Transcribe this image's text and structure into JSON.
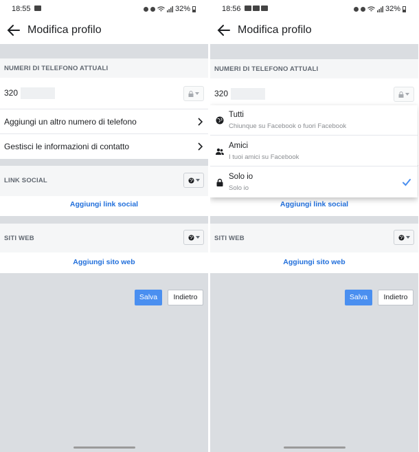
{
  "left": {
    "status": {
      "time": "18:55",
      "battery": "32%"
    },
    "appbar": {
      "title": "Modifica profilo"
    },
    "phones": {
      "header": "NUMERI DI TELEFONO ATTUALI",
      "prefix": "320"
    },
    "rows": [
      {
        "label": "Aggiungi un altro numero di telefono"
      },
      {
        "label": "Gestisci le informazioni di contatto"
      }
    ],
    "social": {
      "header": "LINK SOCIAL",
      "link": "Aggiungi link social"
    },
    "web": {
      "header": "SITI WEB",
      "link": "Aggiungi sito web"
    },
    "buttons": {
      "save": "Salva",
      "back": "Indietro"
    }
  },
  "right": {
    "status": {
      "time": "18:56",
      "battery": "32%"
    },
    "appbar": {
      "title": "Modifica profilo"
    },
    "phones": {
      "header": "NUMERI DI TELEFONO ATTUALI",
      "prefix": "320"
    },
    "dropdown": {
      "items": [
        {
          "title": "Tutti",
          "subtitle": "Chiunque su Facebook o fuori Facebook",
          "icon": "globe-icon"
        },
        {
          "title": "Amici",
          "subtitle": "I tuoi amici su Facebook",
          "icon": "friends-icon"
        },
        {
          "title": "Solo io",
          "subtitle": "Solo io",
          "icon": "lock-icon",
          "selected": true
        }
      ]
    },
    "social": {
      "link": "Aggiungi link social"
    },
    "web": {
      "header": "SITI WEB",
      "link": "Aggiungi sito web"
    },
    "buttons": {
      "save": "Salva",
      "back": "Indietro"
    }
  },
  "colors": {
    "link": "#216fdb",
    "save": "#4a8ff0",
    "check": "#4a8ff0",
    "background": "#dadde1"
  }
}
